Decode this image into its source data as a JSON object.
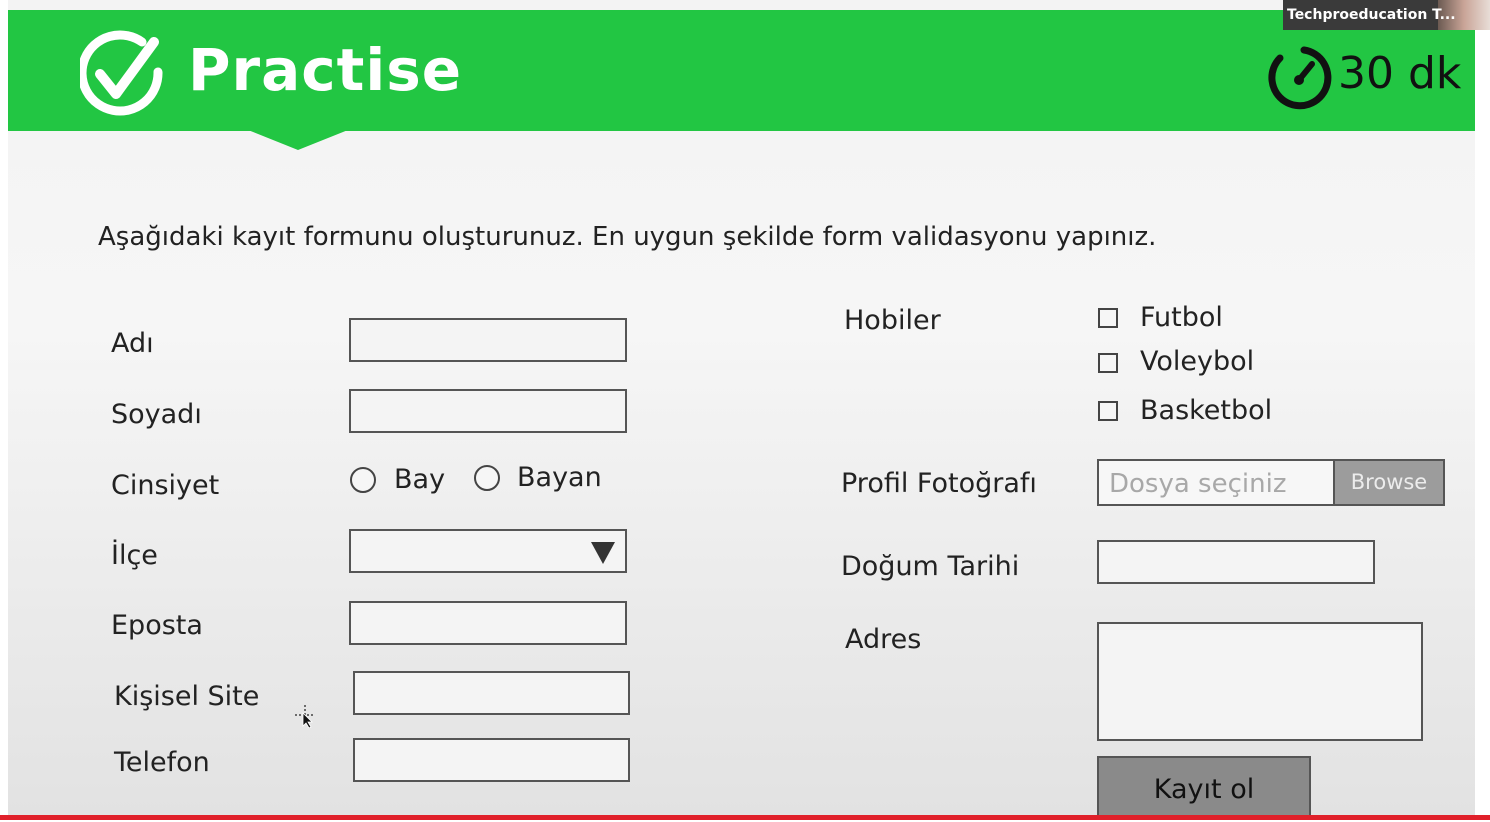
{
  "header": {
    "brand": "Practise",
    "timer": "30 dk",
    "video_name": "Techproeducation T..."
  },
  "instruction": "Aşağıdaki kayıt formunu oluşturunuz. En uygun şekilde form validasyonu yapınız.",
  "left_form": {
    "adi": "Adı",
    "soyadi": "Soyadı",
    "cinsiyet": "Cinsiyet",
    "cinsiyet_options": [
      "Bay",
      "Bayan"
    ],
    "ilce": "İlçe",
    "eposta": "Eposta",
    "kisisel_site": "Kişisel Site",
    "telefon": "Telefon"
  },
  "right_form": {
    "hobiler": "Hobiler",
    "hobi_options": [
      "Futbol",
      "Voleybol",
      "Basketbol"
    ],
    "profil_fotografi": "Profil Fotoğrafı",
    "file_placeholder": "Dosya seçiniz",
    "browse_label": "Browse",
    "dogum_tarihi": "Doğum Tarihi",
    "adres": "Adres",
    "submit_label": "Kayıt ol"
  },
  "colors": {
    "header_green": "#22c643",
    "footer_red": "#e0202a"
  },
  "icons": {
    "logo": "check-circle-icon",
    "timer": "stopwatch-icon",
    "dropdown": "triangle-down-icon",
    "cursor": "move-cursor-icon"
  }
}
